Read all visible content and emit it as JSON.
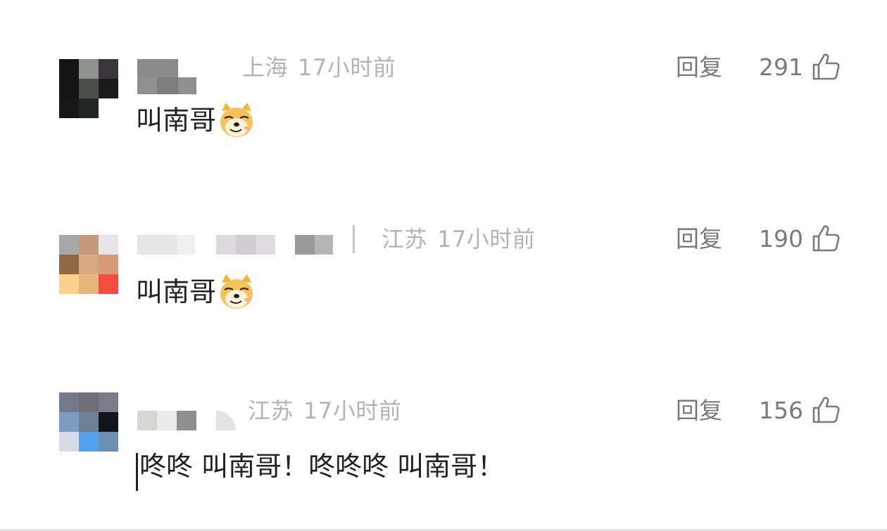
{
  "comments": [
    {
      "location": "上海",
      "time": "17小时前",
      "reply_label": "回复",
      "likes": "291",
      "text": "叫南哥",
      "has_emoji": true,
      "emoji": "doge-emoji"
    },
    {
      "location": "江苏",
      "time": "17小时前",
      "reply_label": "回复",
      "likes": "190",
      "text": "叫南哥",
      "has_emoji": true,
      "emoji": "doge-emoji"
    },
    {
      "location": "江苏",
      "time": "17小时前",
      "reply_label": "回复",
      "likes": "156",
      "text": "咚咚 叫南哥！咚咚咚 叫南哥！",
      "has_emoji": false
    }
  ],
  "icons": {
    "like": "thumbs-up-icon"
  },
  "colors": {
    "meta_text": "#b3b3b3",
    "action_text": "#7a7a7a",
    "body_text": "#222222"
  }
}
